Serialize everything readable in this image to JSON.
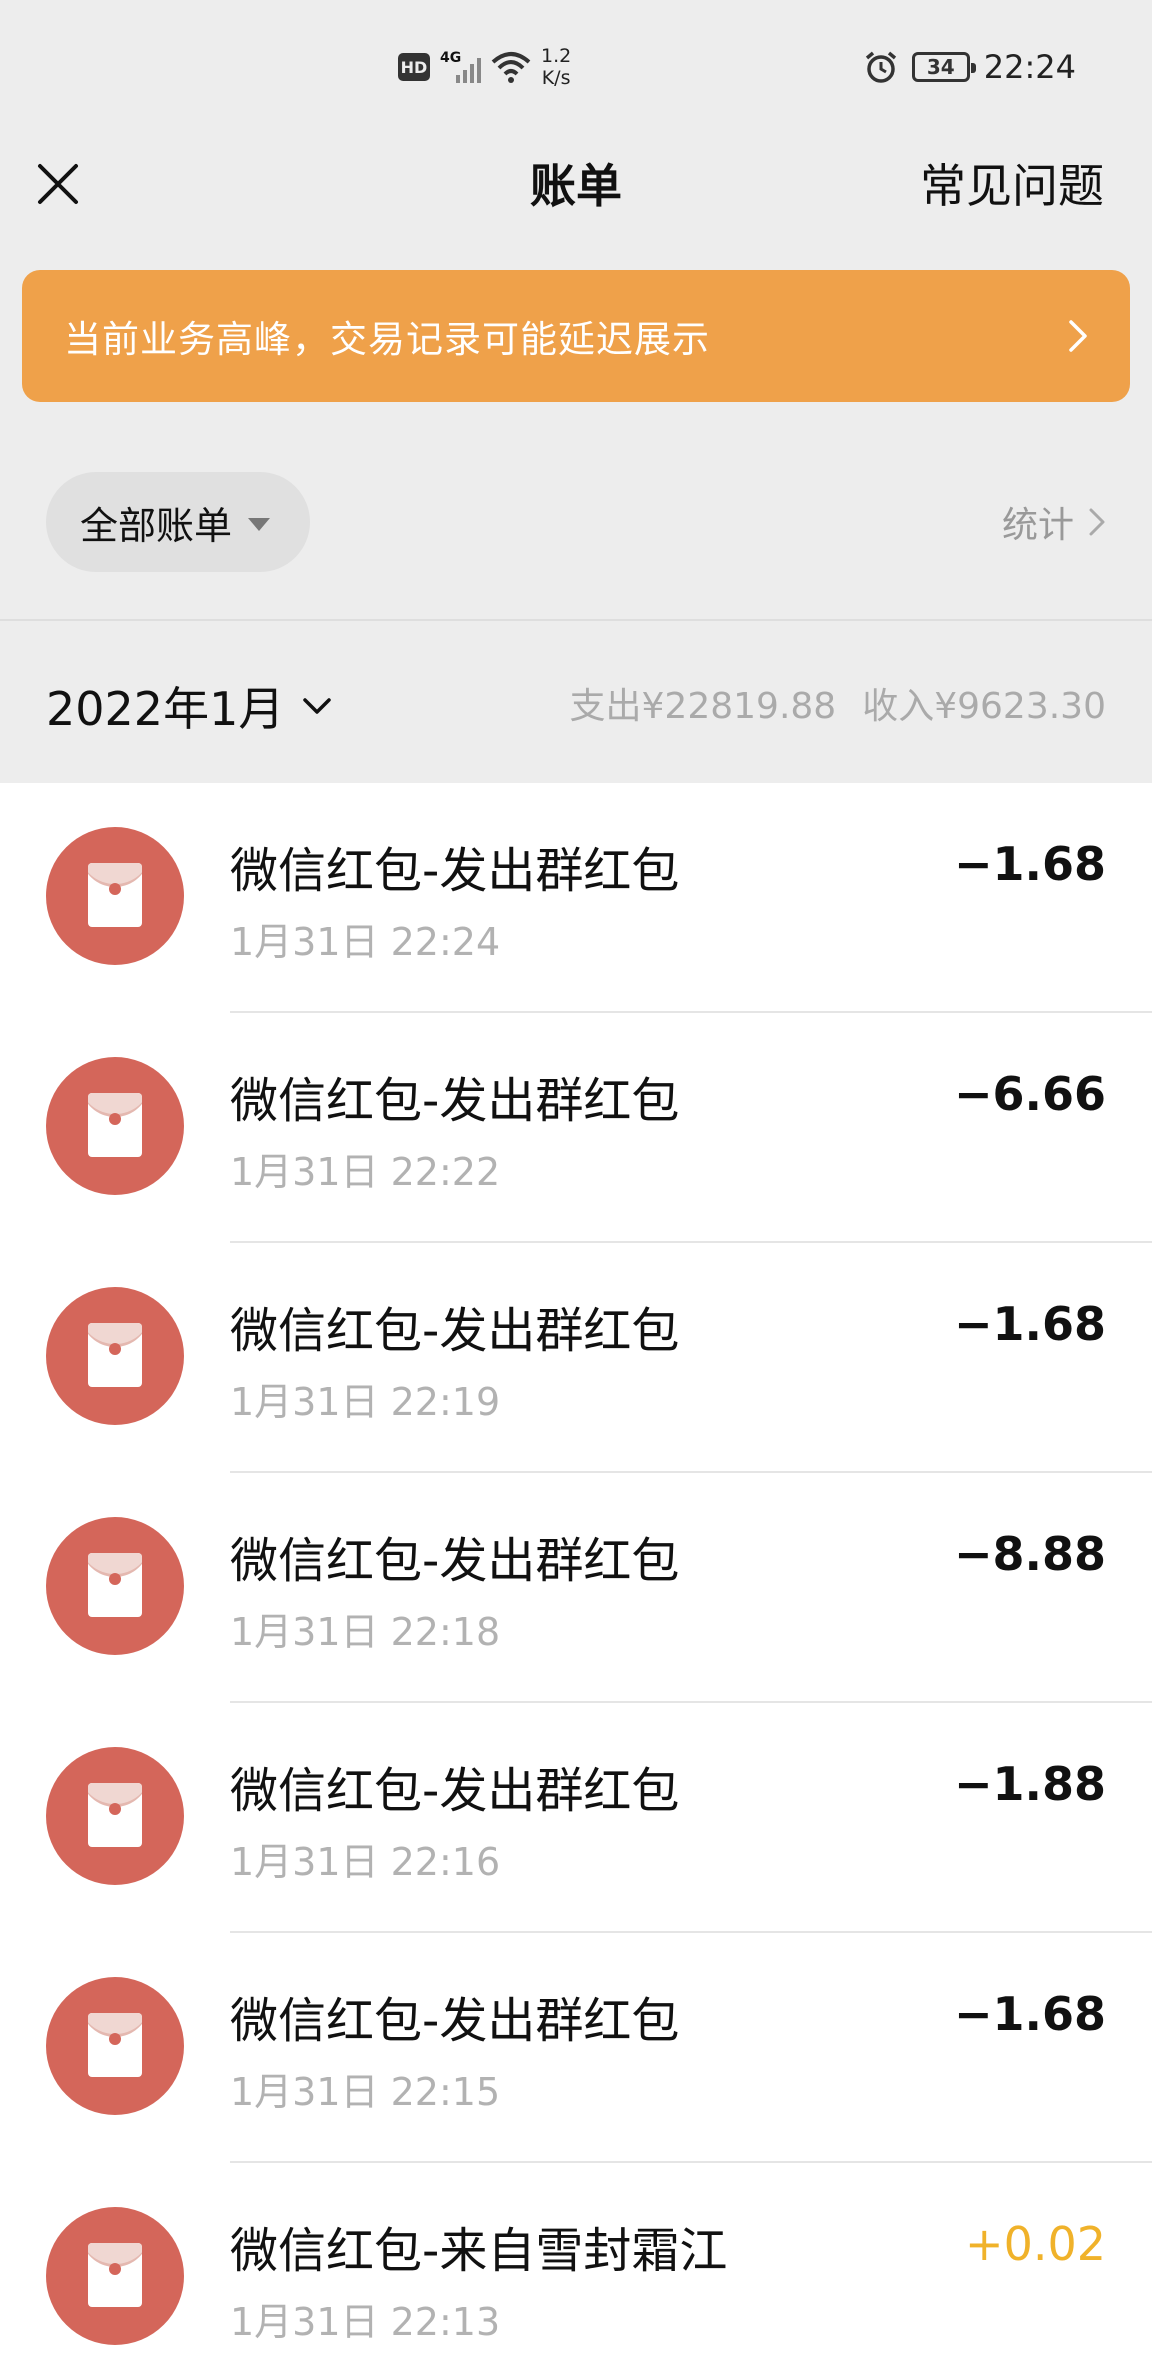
{
  "status_bar": {
    "hd": "HD",
    "network": "4G",
    "speed_value": "1.2",
    "speed_unit": "K/s",
    "battery": "34",
    "time": "22:24"
  },
  "nav": {
    "title": "账单",
    "faq_label": "常见问题"
  },
  "banner": {
    "text": "当前业务高峰，交易记录可能延迟展示"
  },
  "filter": {
    "label": "全部账单",
    "stats_label": "统计"
  },
  "month": {
    "label": "2022年1月",
    "expense": "支出¥22819.88",
    "income": "收入¥9623.30"
  },
  "transactions": [
    {
      "title": "微信红包-发出群红包",
      "time": "1月31日 22:24",
      "amount": "−1.68",
      "type": "expense"
    },
    {
      "title": "微信红包-发出群红包",
      "time": "1月31日 22:22",
      "amount": "−6.66",
      "type": "expense"
    },
    {
      "title": "微信红包-发出群红包",
      "time": "1月31日 22:19",
      "amount": "−1.68",
      "type": "expense"
    },
    {
      "title": "微信红包-发出群红包",
      "time": "1月31日 22:18",
      "amount": "−8.88",
      "type": "expense"
    },
    {
      "title": "微信红包-发出群红包",
      "time": "1月31日 22:16",
      "amount": "−1.88",
      "type": "expense"
    },
    {
      "title": "微信红包-发出群红包",
      "time": "1月31日 22:15",
      "amount": "−1.68",
      "type": "expense"
    },
    {
      "title": "微信红包-来自雪封霜江",
      "time": "1月31日 22:13",
      "amount": "+0.02",
      "type": "income"
    }
  ],
  "colors": {
    "banner": "#efa14a",
    "icon": "#d4665a",
    "income": "#f0b22a"
  }
}
